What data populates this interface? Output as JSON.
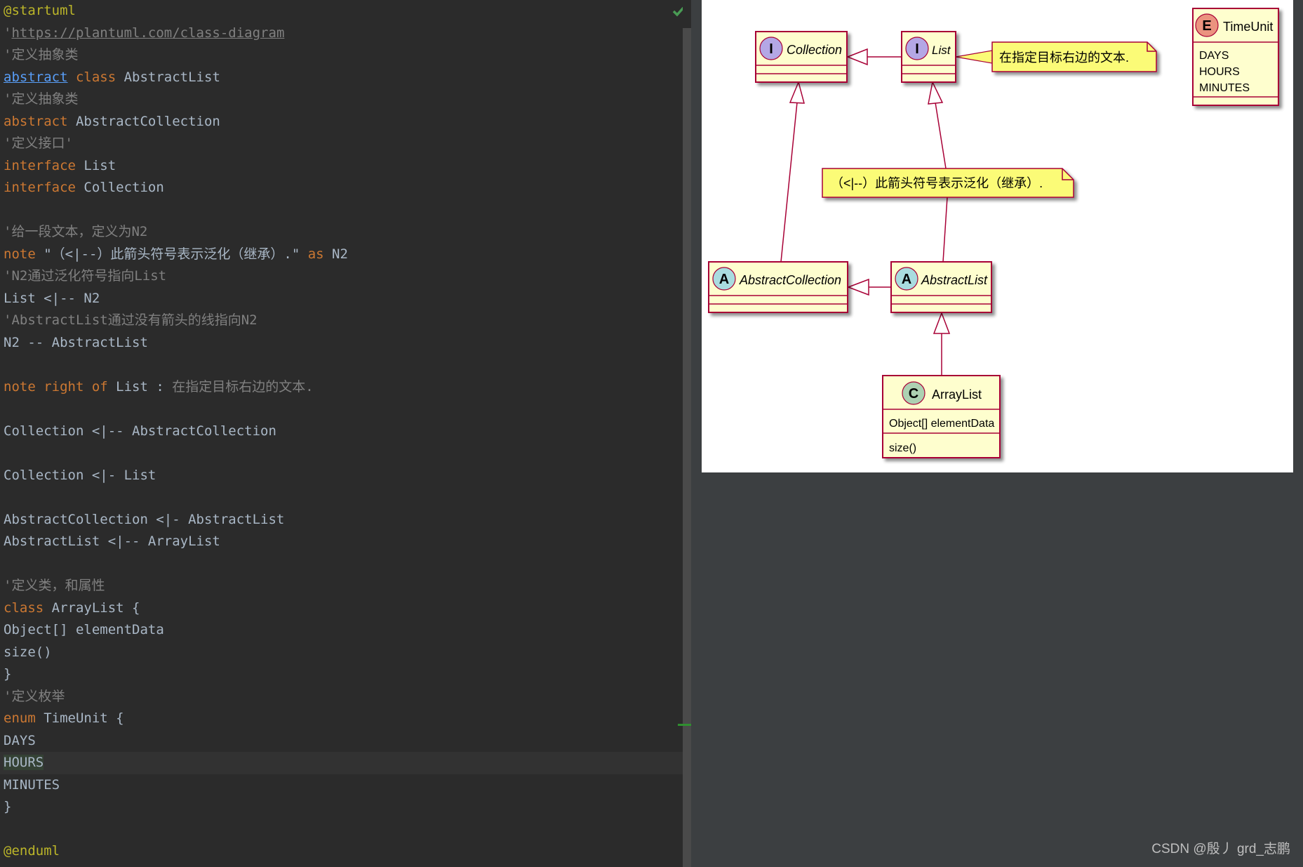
{
  "editor": {
    "lines": [
      [
        {
          "t": "@startuml",
          "c": "dir"
        }
      ],
      [
        {
          "t": "'",
          "c": "cmt"
        },
        {
          "t": "https://plantuml.com/class-diagram",
          "c": "link"
        }
      ],
      [
        {
          "t": "'定义抽象类",
          "c": "cmt"
        }
      ],
      [
        {
          "t": "abstract",
          "c": "kwlink"
        },
        {
          "t": " "
        },
        {
          "t": "class",
          "c": "kw"
        },
        {
          "t": " AbstractList"
        }
      ],
      [
        {
          "t": "'定义抽象类",
          "c": "cmt"
        }
      ],
      [
        {
          "t": "abstract",
          "c": "kw"
        },
        {
          "t": " AbstractCollection"
        }
      ],
      [
        {
          "t": "'定义接口'",
          "c": "cmt"
        }
      ],
      [
        {
          "t": "interface",
          "c": "kw"
        },
        {
          "t": " List"
        }
      ],
      [
        {
          "t": "interface",
          "c": "kw"
        },
        {
          "t": " Collection"
        }
      ],
      [],
      [
        {
          "t": "'给一段文本，定义为N2",
          "c": "cmt"
        }
      ],
      [
        {
          "t": "note",
          "c": "kw"
        },
        {
          "t": " \"（<|--）此箭头符号表示泛化（继承）.\" "
        },
        {
          "t": "as",
          "c": "kw"
        },
        {
          "t": " N2"
        }
      ],
      [
        {
          "t": "'N2通过泛化符号指向List",
          "c": "cmt"
        }
      ],
      [
        {
          "t": "List <|-- N2"
        }
      ],
      [
        {
          "t": "'AbstractList通过没有箭头的线指向N2",
          "c": "cmt"
        }
      ],
      [
        {
          "t": "N2 -- AbstractList"
        }
      ],
      [],
      [
        {
          "t": "note right of",
          "c": "kw"
        },
        {
          "t": " List : "
        },
        {
          "t": "在指定目标右边的文本.",
          "c": "cmt"
        }
      ],
      [],
      [
        {
          "t": "Collection <|-- AbstractCollection"
        }
      ],
      [],
      [
        {
          "t": "Collection <|- List"
        }
      ],
      [],
      [
        {
          "t": "AbstractCollection <|- AbstractList"
        }
      ],
      [
        {
          "t": "AbstractList <|-- ArrayList"
        }
      ],
      [],
      [
        {
          "t": "'定义类，和属性",
          "c": "cmt"
        }
      ],
      [
        {
          "t": "class",
          "c": "kw"
        },
        {
          "t": " ArrayList {"
        }
      ],
      [
        {
          "t": "Object[] elementData"
        }
      ],
      [
        {
          "t": "size()"
        }
      ],
      [
        {
          "t": "}"
        }
      ],
      [
        {
          "t": "'定义枚举",
          "c": "cmt"
        }
      ],
      [
        {
          "t": "enum",
          "c": "kw"
        },
        {
          "t": " TimeUnit {"
        }
      ],
      [
        {
          "t": "DAYS"
        }
      ],
      [
        {
          "t": "HOURS",
          "c": "hl"
        }
      ],
      [
        {
          "t": "MINUTES"
        }
      ],
      [
        {
          "t": "}"
        }
      ],
      [],
      [
        {
          "t": "@enduml",
          "c": "dir"
        }
      ]
    ],
    "current_line_index": 34,
    "status_icon": "check-icon"
  },
  "diagram": {
    "classes": {
      "collection": {
        "stereo": "I",
        "name": "Collection",
        "kind": "interface"
      },
      "list": {
        "stereo": "I",
        "name": "List",
        "kind": "interface"
      },
      "abstract_collection": {
        "stereo": "A",
        "name": "AbstractCollection",
        "kind": "abstract"
      },
      "abstract_list": {
        "stereo": "A",
        "name": "AbstractList",
        "kind": "abstract"
      },
      "array_list": {
        "stereo": "C",
        "name": "ArrayList",
        "kind": "class",
        "fields": [
          "Object[] elementData"
        ],
        "methods": [
          "size()"
        ]
      },
      "time_unit": {
        "stereo": "E",
        "name": "TimeUnit",
        "kind": "enum",
        "values": [
          "DAYS",
          "HOURS",
          "MINUTES"
        ]
      }
    },
    "notes": {
      "list_note": "在指定目标右边的文本.",
      "n2": "（<|--）此箭头符号表示泛化（继承）."
    },
    "colors": {
      "class_fill": "#fefece",
      "border": "#a80036",
      "note_fill": "#fbfb77",
      "interface_badge": "#b4a7e5",
      "abstract_badge": "#a9dcdf",
      "class_badge": "#add1b2",
      "enum_badge": "#eb937f"
    }
  },
  "watermark": "CSDN @殷丿 grd_志鹏"
}
